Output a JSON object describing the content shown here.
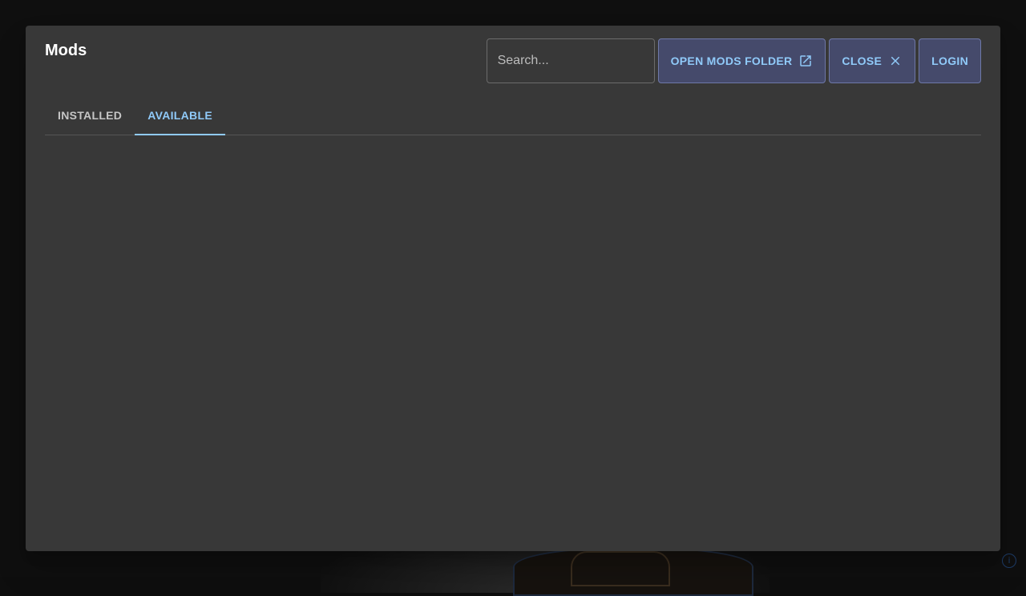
{
  "dialog": {
    "title": "Mods",
    "search": {
      "placeholder": "Search...",
      "value": ""
    },
    "buttons": {
      "open_folder": {
        "label": "OPEN MODS FOLDER",
        "icon": "open-in-new-icon"
      },
      "close": {
        "label": "CLOSE",
        "icon": "close-icon"
      },
      "login": {
        "label": "LOGIN"
      }
    },
    "tabs": [
      {
        "label": "INSTALLED",
        "active": false
      },
      {
        "label": "AVAILABLE",
        "active": true
      }
    ]
  },
  "colors": {
    "accent": "#90caf9",
    "dialog_bg": "#383838",
    "button_bg": "#454a6b"
  }
}
